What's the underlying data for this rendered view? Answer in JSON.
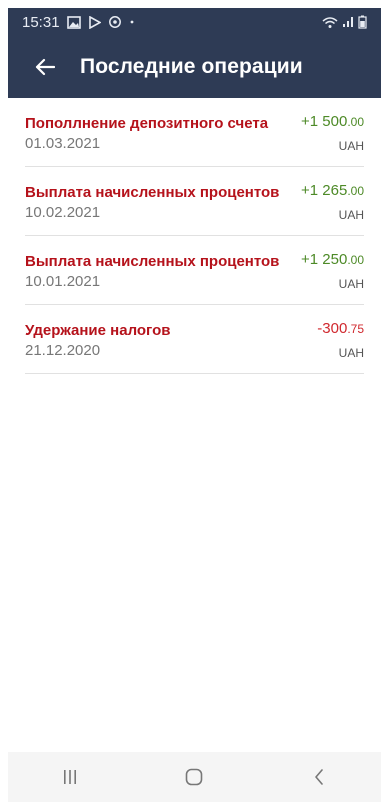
{
  "status_bar": {
    "time": "15:31",
    "icons_left": [
      "gallery-icon",
      "play-store-icon",
      "sync-icon",
      "dot-icon"
    ],
    "icons_right": [
      "wifi-icon",
      "signal-icon",
      "battery-icon"
    ]
  },
  "app_bar": {
    "back_icon": "arrow-left-icon",
    "title": "Последние операции"
  },
  "transactions": [
    {
      "title": "Пополлнение депозитного счета",
      "date": "01.03.2021",
      "amount_main": "+1 500",
      "amount_frac": ".00",
      "currency": "UAH",
      "sign": "positive"
    },
    {
      "title": "Выплата начисленных процентов",
      "date": "10.02.2021",
      "amount_main": "+1 265",
      "amount_frac": ".00",
      "currency": "UAH",
      "sign": "positive"
    },
    {
      "title": "Выплата начисленных процентов",
      "date": "10.01.2021",
      "amount_main": "+1 250",
      "amount_frac": ".00",
      "currency": "UAH",
      "sign": "positive"
    },
    {
      "title": "Удержание налогов",
      "date": "21.12.2020",
      "amount_main": "-300",
      "amount_frac": ".75",
      "currency": "UAH",
      "sign": "negative"
    }
  ],
  "colors": {
    "app_bar": "#2e3b55",
    "title_red": "#b5121b",
    "positive": "#4d8a27",
    "negative": "#d0282e"
  },
  "nav_bar": {
    "buttons": [
      "recents-icon",
      "home-icon",
      "back-icon"
    ]
  }
}
